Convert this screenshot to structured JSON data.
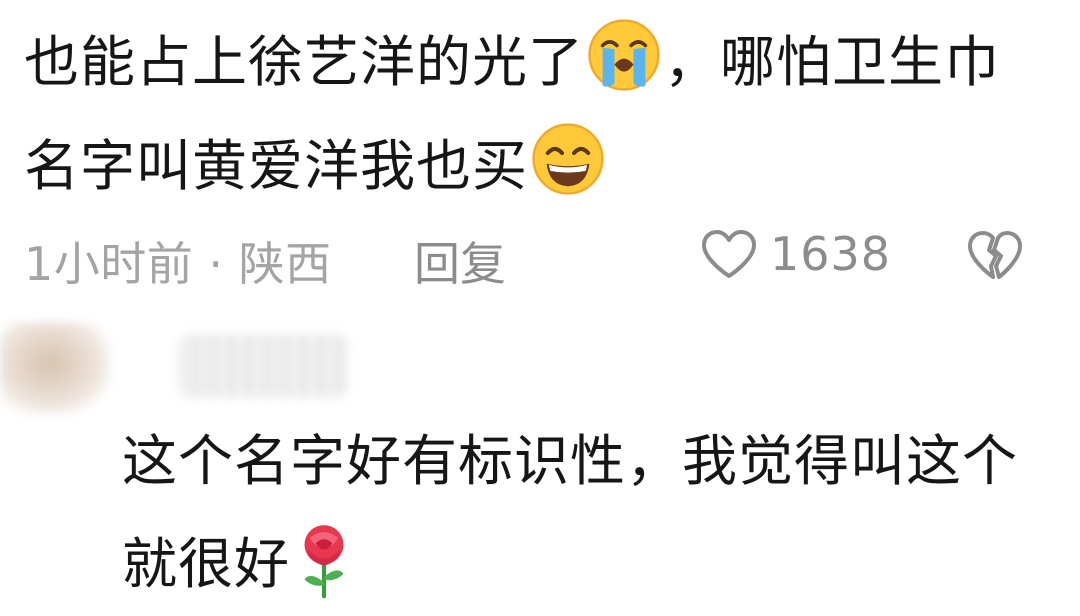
{
  "comment": {
    "text_part1": "也能占上徐艺洋的光了",
    "emoji1": "loudly-crying-face-emoji",
    "text_part2": "，哪怕卫生巾名字叫黄爱洋我也买",
    "emoji2": "grinning-face-emoji",
    "time": "1小时前 · 陕西",
    "reply_label": "回复",
    "like_count": "1638"
  },
  "reply": {
    "text": "这个名字好有标识性，我觉得叫这个就很好",
    "emoji": "rose-emoji"
  },
  "colors": {
    "text": "#161616",
    "meta": "#a4a4a4",
    "icon": "#8c8c8c",
    "emoji_face": "#ffc93a",
    "tears": "#5ab4f0",
    "rose": "#e8384f"
  }
}
